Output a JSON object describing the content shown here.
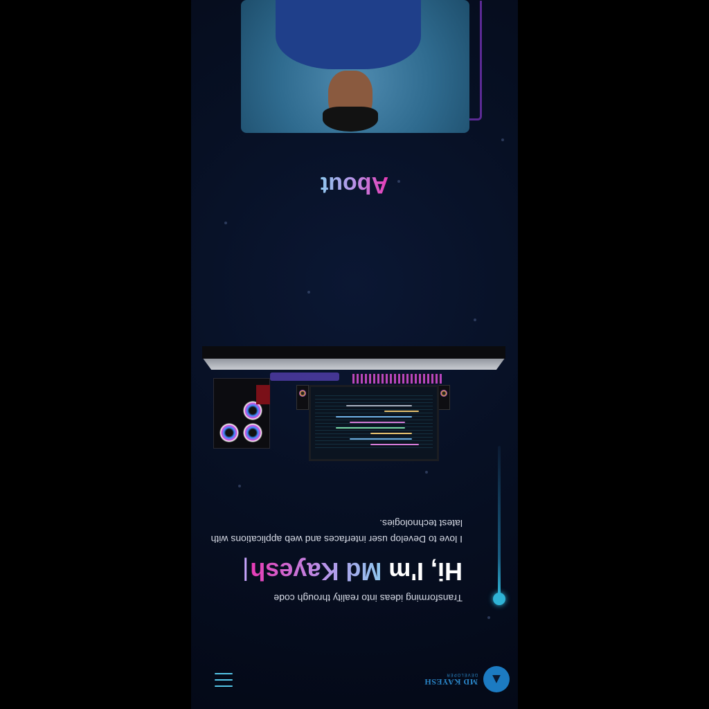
{
  "header": {
    "logo_mark": "▲",
    "logo_name": "MD KAYESH",
    "logo_subtitle": "DEVELOPER"
  },
  "hero": {
    "tagline": "Transforming ideas into reality through code",
    "title_prefix": "Hi, I'm ",
    "title_name": "Md Kayesh",
    "caret": "|",
    "description": "I love to Develop user interfaces and web applications with latest technologies."
  },
  "about": {
    "title": "About"
  },
  "colors": {
    "background": "#050b1a",
    "accent_cyan": "#2fb3d6",
    "accent_pink": "#e83ab5",
    "accent_violet": "#b991e8",
    "accent_blue": "#8fc7ee"
  },
  "icons": {
    "menu": "hamburger-menu-icon",
    "logo": "logo-badge-icon"
  }
}
